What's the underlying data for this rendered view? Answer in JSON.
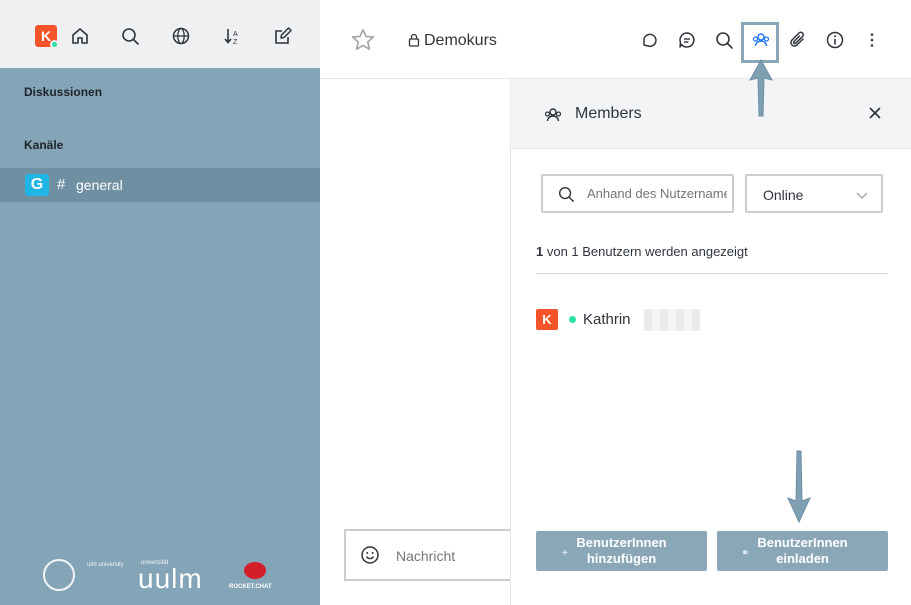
{
  "sidebar": {
    "user_initial": "K",
    "section_discussions": "Diskussionen",
    "section_channels": "Kanäle",
    "channel": {
      "initial": "G",
      "hash": "#",
      "label": "general"
    },
    "footer": {
      "uni_small": "ulm university",
      "uni_small2": "universität",
      "uni_big": "uulm",
      "rocket_label": "ROCKET.CHAT"
    }
  },
  "header": {
    "room_name": "Demokurs"
  },
  "composer": {
    "placeholder": "Nachricht"
  },
  "panel": {
    "title": "Members",
    "search_placeholder": "Anhand des Nutzernamens suchen",
    "status_value": "Online",
    "count_bold": "1",
    "count_rest": " von 1 Benutzern werden angezeigt",
    "member": {
      "initial": "K",
      "name": "Kathrin"
    },
    "add_button": {
      "icon": "+",
      "line1": "BenutzerInnen",
      "line2": "hinzufügen"
    },
    "invite_button": {
      "icon": "⚭",
      "line1": "BenutzerInnen",
      "line2": "einladen"
    }
  },
  "colors": {
    "sidebar_bg": "#84a4b7",
    "accent": "#1d74f5",
    "avatar_orange": "#f5542b",
    "online": "#2de0a5",
    "button_bg": "#8aa7b8"
  }
}
